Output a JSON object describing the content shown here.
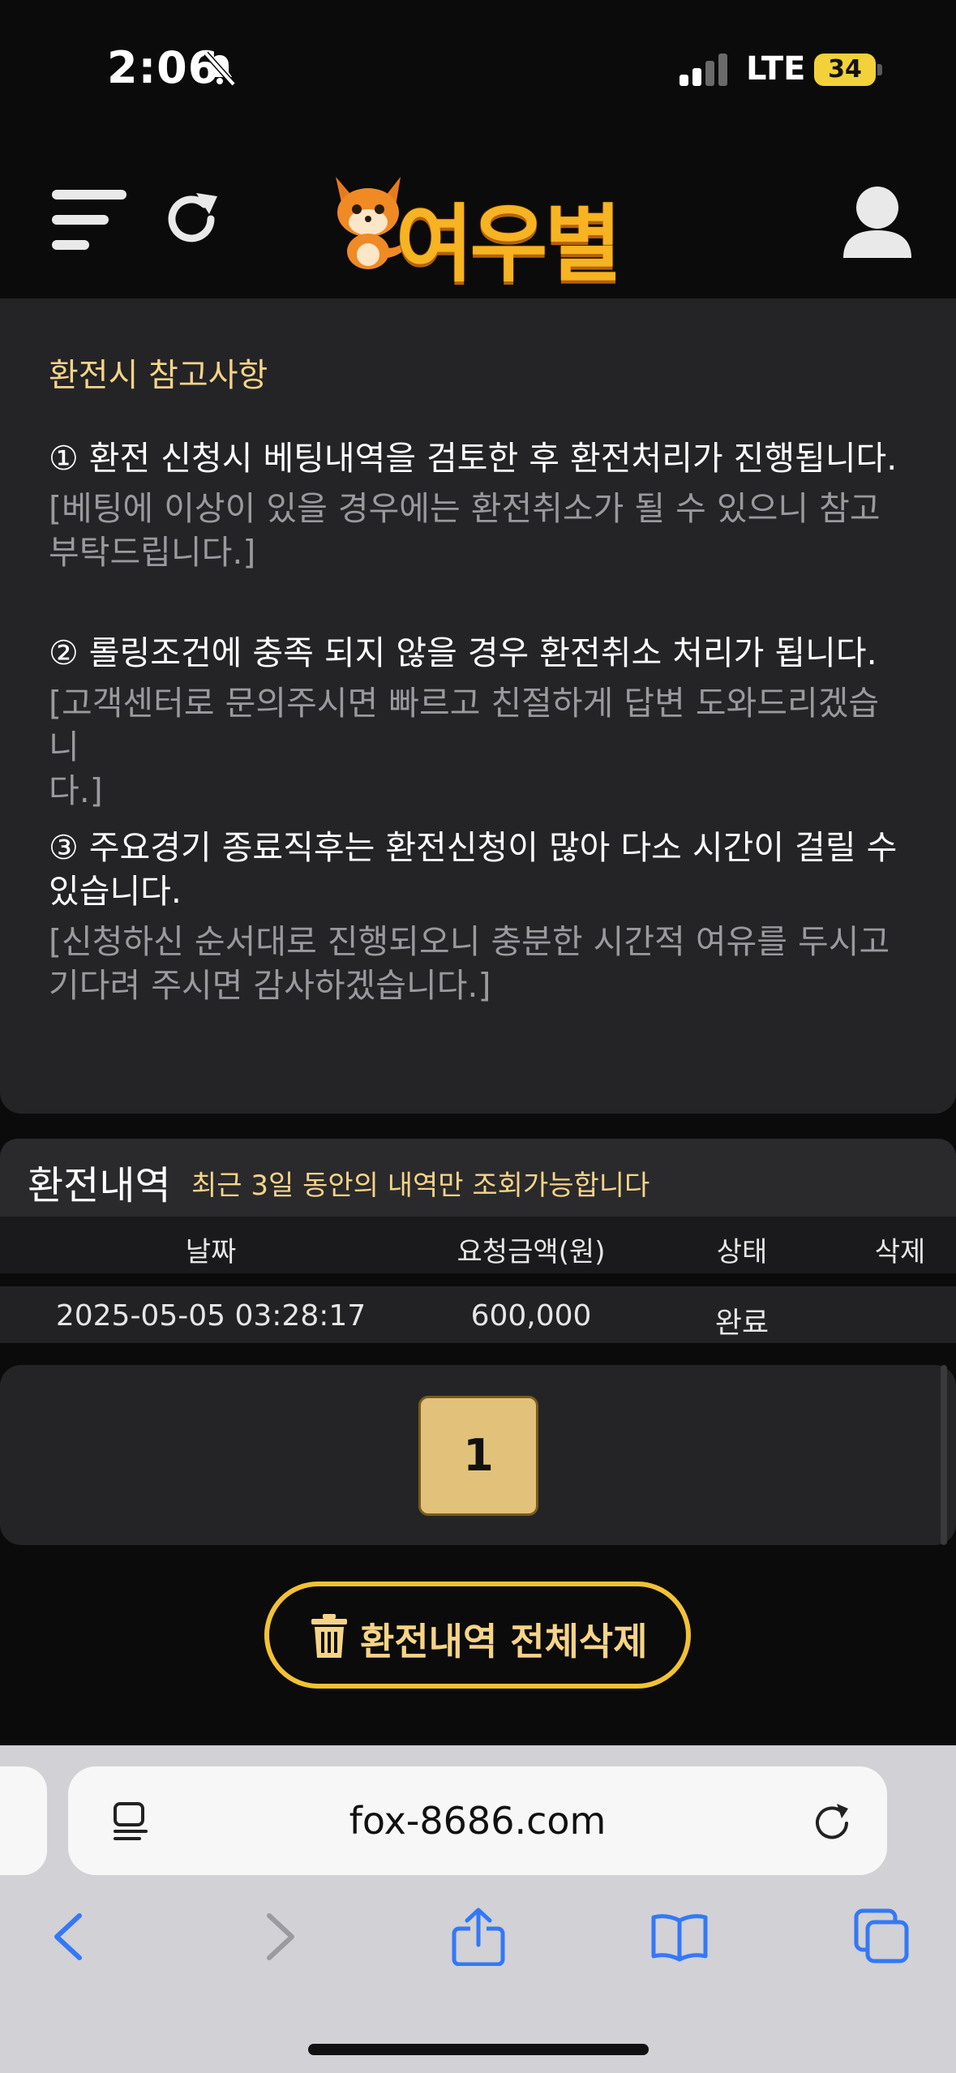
{
  "status_bar": {
    "time": "2:06",
    "network": "LTE",
    "battery": "34"
  },
  "header": {
    "logo_text": "여우별"
  },
  "notice": {
    "title": "환전시 참고사항",
    "items": [
      {
        "main": "① 환전 신청시 베팅내역을 검토한 후 환전처리가 진행됩니다.",
        "sub_line1": "[베팅에 이상이 있을 경우에는 환전취소가 될 수 있으니 참고",
        "sub_line2": "부탁드립니다.]"
      },
      {
        "main": "② 롤링조건에 충족 되지 않을 경우 환전취소 처리가 됩니다.",
        "sub_line1": "[고객센터로 문의주시면 빠르고 친절하게 답변 도와드리겠습니",
        "sub_line2": "다.]"
      },
      {
        "main_line1": "③ 주요경기 종료직후는 환전신청이 많아 다소 시간이 걸릴 수",
        "main_line2": "있습니다.",
        "sub_line1": "[신청하신 순서대로 진행되오니 충분한 시간적 여유를 두시고",
        "sub_line2": "기다려 주시면 감사하겠습니다.]"
      }
    ]
  },
  "history": {
    "title": "환전내역",
    "note": "최근 3일 동안의 내역만 조회가능합니다",
    "columns": [
      "날짜",
      "요청금액(원)",
      "상태",
      "삭제"
    ],
    "rows": [
      {
        "date": "2025-05-05 03:28:17",
        "amount": "600,000",
        "status": "완료",
        "delete": ""
      }
    ]
  },
  "pagination": {
    "current_page": "1"
  },
  "delete_all": {
    "label": "환전내역 전체삭제"
  },
  "browser": {
    "url": "fox-8686.com"
  },
  "colors": {
    "accent_gold": "#f2c134",
    "accent_text": "#f6d487",
    "page_button": "#e2c27a",
    "panel": "#242427",
    "ios_blue": "#3478f6"
  }
}
